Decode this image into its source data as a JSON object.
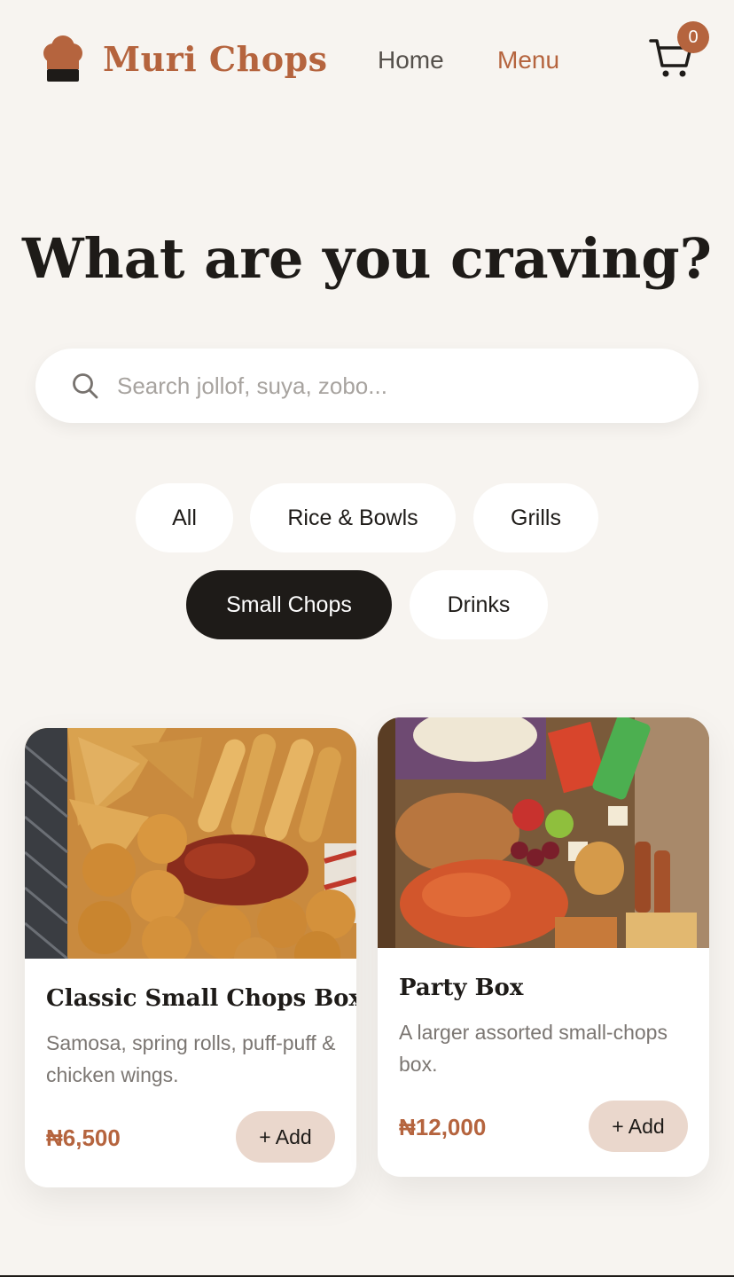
{
  "header": {
    "brand": "Muri Chops",
    "nav": {
      "home": "Home",
      "menu": "Menu"
    },
    "cart_count": "0",
    "colors": {
      "accent": "#b5643e",
      "dark": "#1e1b18",
      "background": "#f7f4f0"
    }
  },
  "hero": {
    "title": "What are you craving?"
  },
  "search": {
    "placeholder": "Search jollof, suya, zobo...",
    "value": ""
  },
  "filters": {
    "items": [
      {
        "label": "All",
        "active": false
      },
      {
        "label": "Rice & Bowls",
        "active": false
      },
      {
        "label": "Grills",
        "active": false
      },
      {
        "label": "Small Chops",
        "active": true
      },
      {
        "label": "Drinks",
        "active": false
      }
    ]
  },
  "products": [
    {
      "title": "Classic Small Chops Box",
      "description": "Samosa, spring rolls, puff-puff & chicken wings.",
      "price": "₦6,500",
      "add_label": "+ Add"
    },
    {
      "title": "Party Box",
      "description": "A larger assorted small-chops box.",
      "price": "₦12,000",
      "add_label": "+ Add"
    }
  ]
}
